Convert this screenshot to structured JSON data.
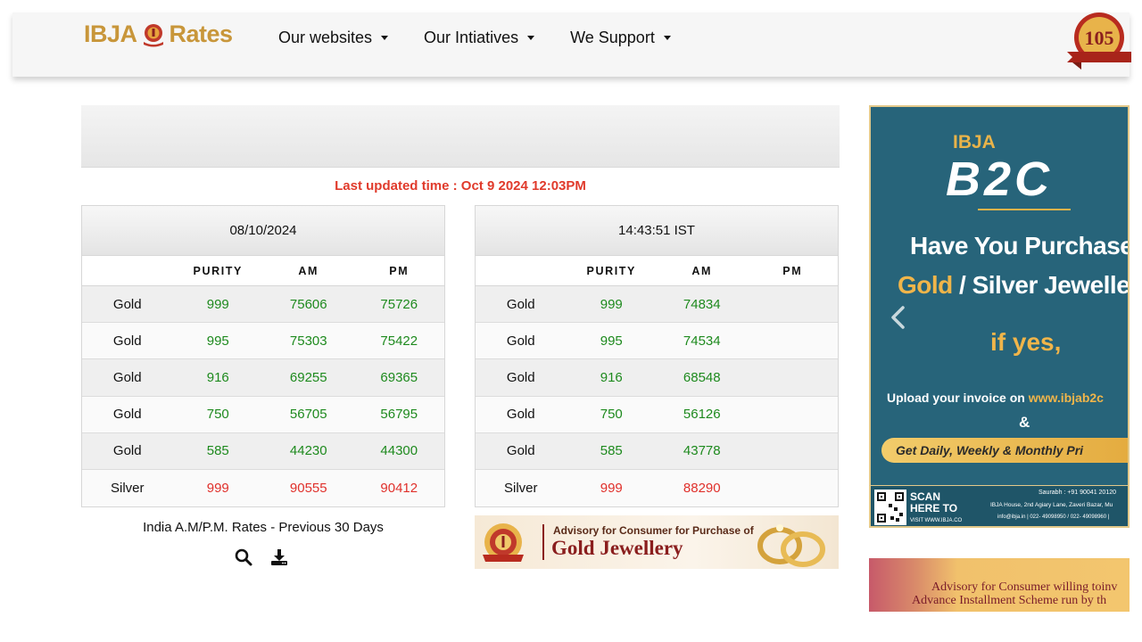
{
  "navbar": {
    "logo_left": "IBJA",
    "logo_right": "Rates",
    "items": [
      {
        "label": "Our websites"
      },
      {
        "label": "Our Intiatives"
      },
      {
        "label": "We Support"
      }
    ],
    "badge_number": "105"
  },
  "updated_text": "Last updated time : Oct 9 2024 12:03PM",
  "left_table": {
    "header": "08/10/2024",
    "columns": [
      "",
      "PURITY",
      "AM",
      "PM"
    ],
    "rows": [
      {
        "metal": "Gold",
        "purity": "999",
        "am": "75606",
        "pm": "75726"
      },
      {
        "metal": "Gold",
        "purity": "995",
        "am": "75303",
        "pm": "75422"
      },
      {
        "metal": "Gold",
        "purity": "916",
        "am": "69255",
        "pm": "69365"
      },
      {
        "metal": "Gold",
        "purity": "750",
        "am": "56705",
        "pm": "56795"
      },
      {
        "metal": "Gold",
        "purity": "585",
        "am": "44230",
        "pm": "44300"
      },
      {
        "metal": "Silver",
        "purity": "999",
        "am": "90555",
        "pm": "90412"
      }
    ]
  },
  "right_table": {
    "header": "14:43:51 IST",
    "columns": [
      "",
      "PURITY",
      "AM",
      "PM"
    ],
    "rows": [
      {
        "metal": "Gold",
        "purity": "999",
        "am": "74834",
        "pm": ""
      },
      {
        "metal": "Gold",
        "purity": "995",
        "am": "74534",
        "pm": ""
      },
      {
        "metal": "Gold",
        "purity": "916",
        "am": "68548",
        "pm": ""
      },
      {
        "metal": "Gold",
        "purity": "750",
        "am": "56126",
        "pm": ""
      },
      {
        "metal": "Gold",
        "purity": "585",
        "am": "43778",
        "pm": ""
      },
      {
        "metal": "Silver",
        "purity": "999",
        "am": "88290",
        "pm": ""
      }
    ]
  },
  "previous_rates_label": "India A.M/P.M. Rates - Previous 30 Days",
  "advisory_banner": {
    "line1": "Advisory for Consumer for Purchase of",
    "line2": "Gold Jewellery"
  },
  "b2c_banner": {
    "ibja": "IBJA",
    "b2c": "B2C",
    "headline1": "Have You Purchased",
    "headline2_gold": "Gold",
    "headline2_rest": " / Silver Jeweller",
    "if_yes": "if yes,",
    "upload_prefix": "Upload your invoice on ",
    "upload_url": "www.ibjab2c",
    "amp": "&",
    "pill": "Get Daily, Weekly & Monthly Pri",
    "scan_here": "SCAN",
    "scan_here2": "HERE TO",
    "visit": "VISIT WWW.IBJA.CO",
    "contact": "Saurabh : +91 90041 20120",
    "address": "IBJA House, 2nd Agiary Lane, Zaveri Bazar, Mu",
    "emails": "info@ibja.in  |  022- 49098950 / 022- 49098960  |"
  },
  "consumer_banner": {
    "line1": "Advisory for Consumer willing toinv",
    "line2": "Advance Installment Scheme run by th"
  },
  "colors": {
    "green": "#1e8a1e",
    "red": "#e0302b",
    "gold": "#c8963a",
    "teal": "#27647a"
  }
}
